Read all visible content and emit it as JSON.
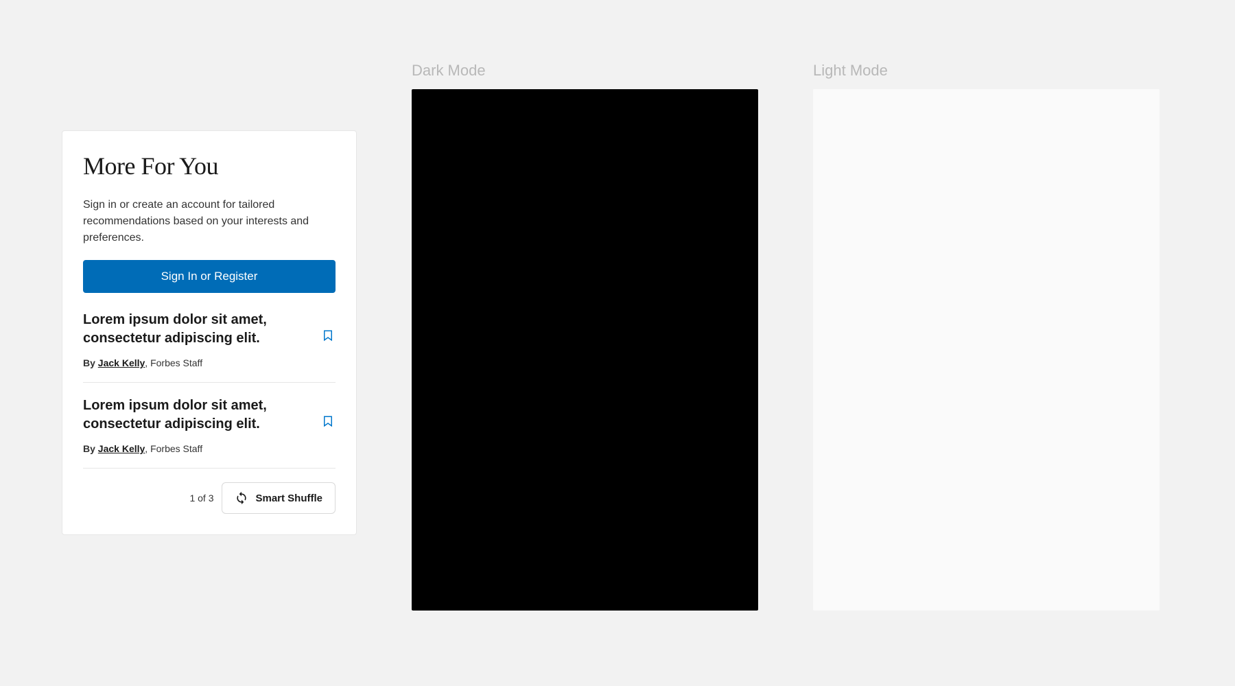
{
  "card": {
    "title": "More For You",
    "description": "Sign in or create an account for tailored recommendations based on your interests and preferences.",
    "sign_in_label": "Sign In or Register"
  },
  "articles": [
    {
      "title": "Lorem ipsum dolor sit amet, consectetur adipiscing elit.",
      "by_prefix": "By ",
      "author": "Jack Kelly",
      "role_suffix": ", Forbes Staff",
      "bookmark_icon": "bookmark-icon"
    },
    {
      "title": "Lorem ipsum dolor sit amet, consectetur adipiscing elit.",
      "by_prefix": "By ",
      "author": "Jack Kelly",
      "role_suffix": ", Forbes Staff",
      "bookmark_icon": "bookmark-icon"
    }
  ],
  "footer": {
    "pager": "1 of 3",
    "shuffle_label": "Smart Shuffle",
    "shuffle_icon": "sync-icon"
  },
  "mode_previews": {
    "dark_label": "Dark Mode",
    "light_label": "Light Mode"
  },
  "colors": {
    "primary_button": "#006cb7",
    "bookmark_stroke": "#0077cc",
    "background": "#f2f2f2",
    "card_bg": "#ffffff"
  }
}
